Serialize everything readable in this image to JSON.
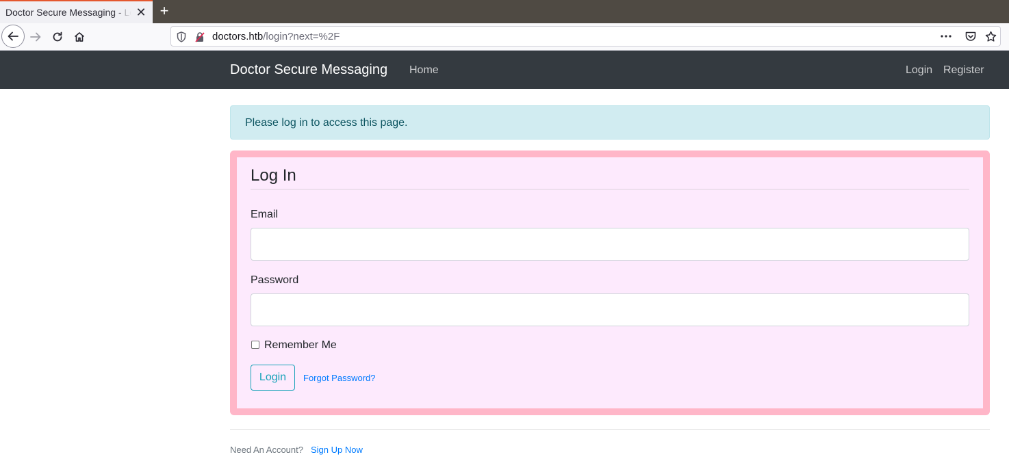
{
  "browser": {
    "tab_title": "Doctor Secure Messaging - Log In",
    "tab_close": "✕",
    "new_tab": "+",
    "url_host": "doctors.htb",
    "url_path": "/login?next=%2F"
  },
  "navbar": {
    "brand": "Doctor Secure Messaging",
    "home": "Home",
    "login": "Login",
    "register": "Register"
  },
  "alert": {
    "message": "Please log in to access this page."
  },
  "form": {
    "legend": "Log In",
    "email_label": "Email",
    "email_value": "",
    "password_label": "Password",
    "password_value": "",
    "remember_label": "Remember Me",
    "submit_label": "Login",
    "forgot_label": "Forgot Password?"
  },
  "footer": {
    "prompt": "Need An Account?",
    "signup": "Sign Up Now"
  },
  "colors": {
    "navbar_bg": "#343a40",
    "alert_bg": "#d1ecf1",
    "card_bg": "#fdeafd",
    "card_border": "#ffb6c8",
    "accent": "#17a2b8",
    "link": "#007bff"
  }
}
